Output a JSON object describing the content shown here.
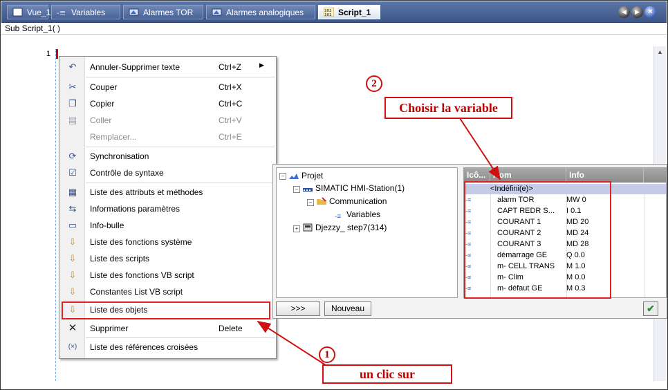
{
  "tabs": [
    {
      "label": "Vue_1",
      "icon": "screen-icon"
    },
    {
      "label": "Variables",
      "icon": "variables-icon"
    },
    {
      "label": "Alarmes TOR",
      "icon": "alarm-icon"
    },
    {
      "label": "Alarmes analogiques",
      "icon": "alarm-icon"
    },
    {
      "label": "Script_1",
      "icon": "script-icon"
    }
  ],
  "editor": {
    "sub_header": "Sub Script_1( )",
    "line_number": "1"
  },
  "context_menu": {
    "items": [
      {
        "label": "Annuler-Supprimer texte",
        "shortcut": "Ctrl+Z",
        "icon": "undo-icon"
      },
      {
        "label": "Couper",
        "shortcut": "Ctrl+X",
        "icon": "scissors-icon"
      },
      {
        "label": "Copier",
        "shortcut": "Ctrl+C",
        "icon": "copy-icon"
      },
      {
        "label": "Coller",
        "shortcut": "Ctrl+V",
        "icon": "paste-icon"
      },
      {
        "label": "Remplacer...",
        "shortcut": "Ctrl+E",
        "icon": ""
      },
      {
        "label": "Synchronisation",
        "shortcut": "",
        "icon": "sync-icon"
      },
      {
        "label": "Contrôle de syntaxe",
        "shortcut": "",
        "icon": "syntax-check-icon"
      },
      {
        "label": "Liste des attributs et méthodes",
        "shortcut": "",
        "icon": "list-icon"
      },
      {
        "label": "Informations paramètres",
        "shortcut": "",
        "icon": "parameter-info-icon"
      },
      {
        "label": "Info-bulle",
        "shortcut": "",
        "icon": "tooltip-icon"
      },
      {
        "label": "Liste des fonctions système",
        "shortcut": "",
        "icon": "list-icon"
      },
      {
        "label": "Liste des scripts",
        "shortcut": "",
        "icon": "list-icon"
      },
      {
        "label": "Liste des fonctions VB script",
        "shortcut": "",
        "icon": "list-icon"
      },
      {
        "label": "Constantes List VB script",
        "shortcut": "",
        "icon": "list-icon"
      },
      {
        "label": "Liste des objets",
        "shortcut": "",
        "icon": "list-icon"
      },
      {
        "label": "Supprimer",
        "shortcut": "Delete",
        "icon": "delete-icon"
      },
      {
        "label": "Liste des références croisées",
        "shortcut": "",
        "icon": "cross-reference-icon"
      }
    ]
  },
  "variable_dialog": {
    "tree": [
      {
        "label": "Projet"
      },
      {
        "label": "SIMATIC HMI-Station(1)"
      },
      {
        "label": "Communication"
      },
      {
        "label": "Variables"
      },
      {
        "label": "Djezzy_ step7(314)"
      }
    ],
    "columns": [
      "Icô...",
      "Nom",
      "Info"
    ],
    "undefined_row": "<Indéfini(e)>",
    "rows": [
      {
        "icon": "variable-icon",
        "name": "alarm TOR",
        "info": "MW 0"
      },
      {
        "icon": "variable-icon",
        "name": "CAPT REDR S...",
        "info": "I 0.1"
      },
      {
        "icon": "variable-icon",
        "name": "COURANT 1",
        "info": "MD 20"
      },
      {
        "icon": "variable-icon",
        "name": "COURANT 2",
        "info": "MD 24"
      },
      {
        "icon": "variable-icon",
        "name": "COURANT 3",
        "info": "MD 28"
      },
      {
        "icon": "variable-icon",
        "name": "démarrage GE",
        "info": "Q 0.0"
      },
      {
        "icon": "variable-icon",
        "name": "m- CELL TRANS",
        "info": "M 1.0"
      },
      {
        "icon": "variable-icon",
        "name": "m- Clim",
        "info": "M 0.0"
      },
      {
        "icon": "variable-icon",
        "name": "m- défaut GE",
        "info": "M 0.3"
      }
    ],
    "expand_button": ">>>",
    "new_button": "Nouveau"
  },
  "annotations": {
    "step1_number": "1",
    "step1_text": "un clic sur",
    "step2_number": "2",
    "step2_text": "Choisir la variable",
    "color": "#d01010"
  }
}
